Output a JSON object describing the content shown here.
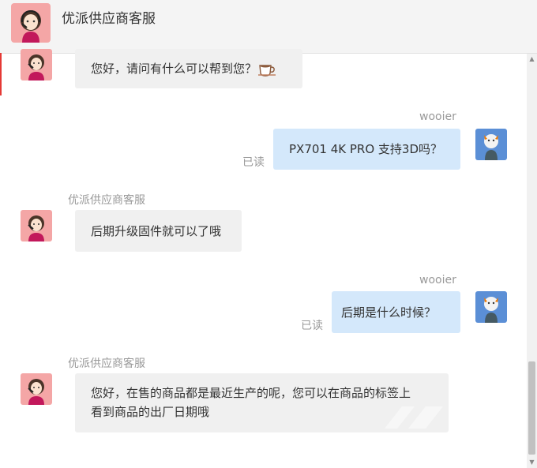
{
  "header": {
    "title": "优派供应商客服"
  },
  "messages": [
    {
      "side": "left",
      "text": "您好，请问有什么可以帮到您？",
      "emoji": "coffee-cup-icon"
    },
    {
      "side": "right",
      "sender": "wooier",
      "text": "PX701 4K PRO 支持3D吗？",
      "status": "已读"
    },
    {
      "side": "left",
      "sender": "优派供应商客服",
      "text": "后期升级固件就可以了哦"
    },
    {
      "side": "right",
      "sender": "wooier",
      "text": "后期是什么时候？",
      "status": "已读"
    },
    {
      "side": "left",
      "sender": "优派供应商客服",
      "text_line1": "您好，在售的商品都是最近生产的呢，您可以在商品的标签上",
      "text_line2": "看到商品的出厂日期哦"
    }
  ],
  "colors": {
    "user_bubble": "#d4e8fb",
    "agent_bubble": "#f0f0f0",
    "accent": "#e53935"
  }
}
